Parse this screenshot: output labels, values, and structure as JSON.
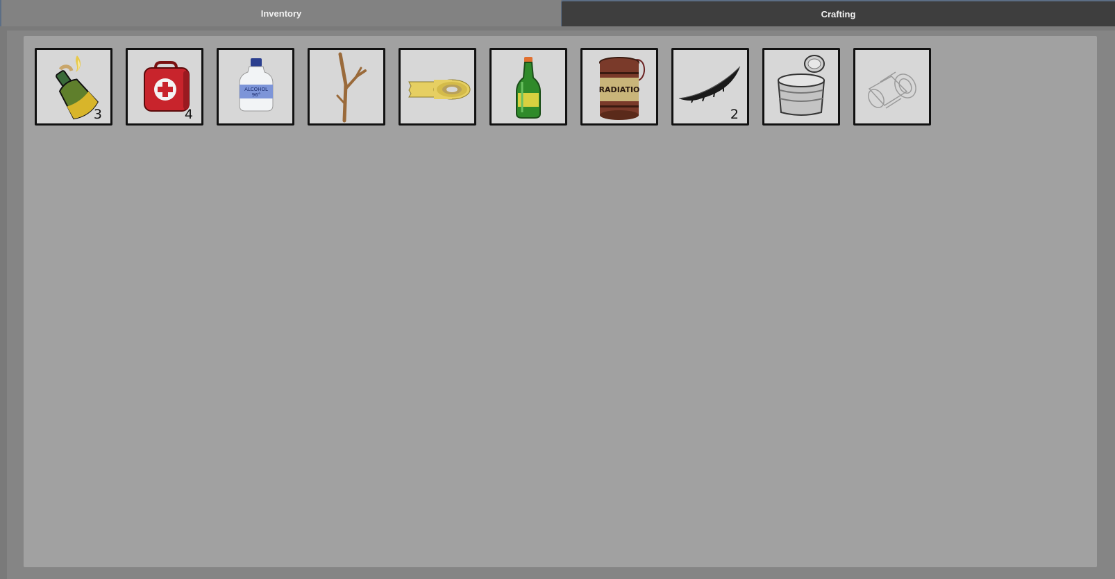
{
  "tabs": [
    {
      "label": "Inventory",
      "active": true
    },
    {
      "label": "Crafting",
      "active": false
    }
  ],
  "inventory": {
    "slots": [
      {
        "item": "molotov-cocktail",
        "icon": "molotov-icon",
        "count": "3"
      },
      {
        "item": "first-aid-kit",
        "icon": "medkit-icon",
        "count": "4"
      },
      {
        "item": "alcohol-bottle",
        "icon": "alcohol-bottle-icon",
        "label": "ALCOHOL 96°",
        "count": ""
      },
      {
        "item": "stick",
        "icon": "stick-icon",
        "count": ""
      },
      {
        "item": "duct-tape",
        "icon": "tape-roll-icon",
        "count": ""
      },
      {
        "item": "green-bottle",
        "icon": "green-bottle-icon",
        "count": ""
      },
      {
        "item": "radiation-barrel",
        "icon": "radiation-barrel-icon",
        "label": "RADIATIO",
        "count": ""
      },
      {
        "item": "feather",
        "icon": "feather-icon",
        "count": "2"
      },
      {
        "item": "tin-can",
        "icon": "tin-can-icon",
        "count": ""
      },
      {
        "item": "pipe-fitting",
        "icon": "pipe-fitting-icon",
        "count": ""
      }
    ]
  }
}
